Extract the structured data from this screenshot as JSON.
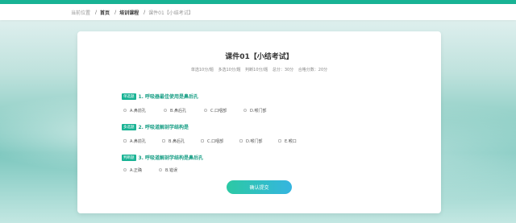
{
  "breadcrumb": {
    "prefix": "当前位置",
    "items": [
      "首页",
      "培训课程",
      "课件01【小结考试】"
    ]
  },
  "exam": {
    "title": "课件01【小结考试】",
    "meta": [
      "单选10分/题",
      "多选10分/题",
      "判断10分/题",
      "总分：30分",
      "合格分数：20分"
    ]
  },
  "questions": [
    {
      "type": "单选题",
      "text": "1. 呼吸器最佳使用是鼻后孔",
      "options": [
        "A.鼻前孔",
        "B.鼻后孔",
        "C.口咽部",
        "D.喉门部"
      ]
    },
    {
      "type": "多选题",
      "text": "2. 呼吸道解剖学结构是",
      "options": [
        "A.鼻前孔",
        "B.鼻后孔",
        "C.口咽部",
        "D.喉门部",
        "E.喉口"
      ]
    },
    {
      "type": "判断题",
      "text": "3. 呼吸道解剖学结构是鼻后孔",
      "options": [
        "A.正确",
        "B.错误"
      ]
    }
  ],
  "submit_label": "确认提交",
  "colors": {
    "accent": "#18b394",
    "button_start": "#2cc9a4",
    "button_end": "#35b5e0"
  }
}
